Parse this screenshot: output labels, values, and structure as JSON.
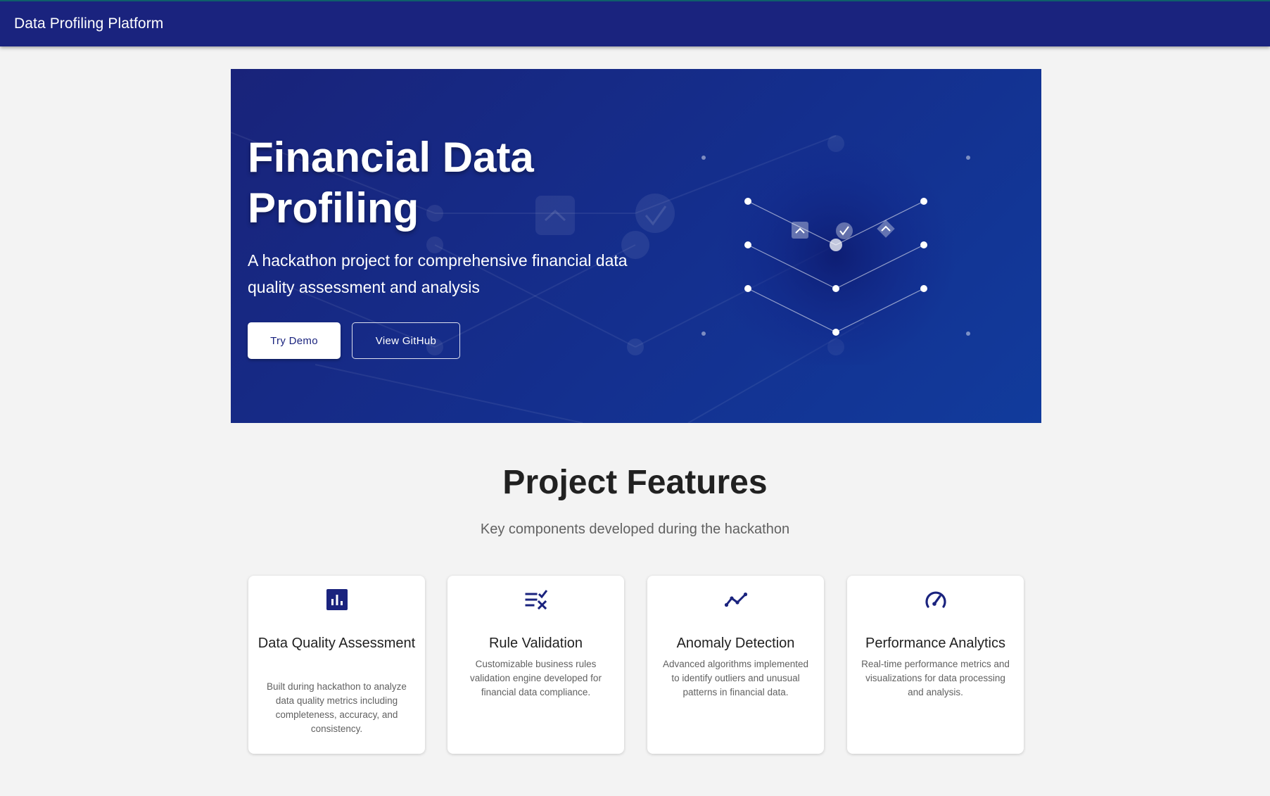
{
  "appbar": {
    "title": "Data Profiling Platform"
  },
  "hero": {
    "title": "Financial Data Profiling",
    "subtitle": "A hackathon project for comprehensive financial data quality assessment and analysis",
    "primary_button": "Try Demo",
    "secondary_button": "View GitHub"
  },
  "features": {
    "title": "Project Features",
    "subtitle": "Key components developed during the hackathon",
    "cards": [
      {
        "icon": "bar-chart-icon",
        "title": "Data Quality Assessment",
        "description": "Built during hackathon to analyze data quality metrics including completeness, accuracy, and consistency."
      },
      {
        "icon": "rule-checklist-icon",
        "title": "Rule Validation",
        "description": "Customizable business rules validation engine developed for financial data compliance."
      },
      {
        "icon": "trend-line-icon",
        "title": "Anomaly Detection",
        "description": "Advanced algorithms implemented to identify outliers and unusual patterns in financial data."
      },
      {
        "icon": "speedometer-icon",
        "title": "Performance Analytics",
        "description": "Real-time performance metrics and visualizations for data processing and analysis."
      }
    ]
  },
  "colors": {
    "primary": "#1a237e",
    "background": "#f3f3f3",
    "card": "#ffffff",
    "text_dark": "#212121",
    "text_muted": "#616161"
  }
}
